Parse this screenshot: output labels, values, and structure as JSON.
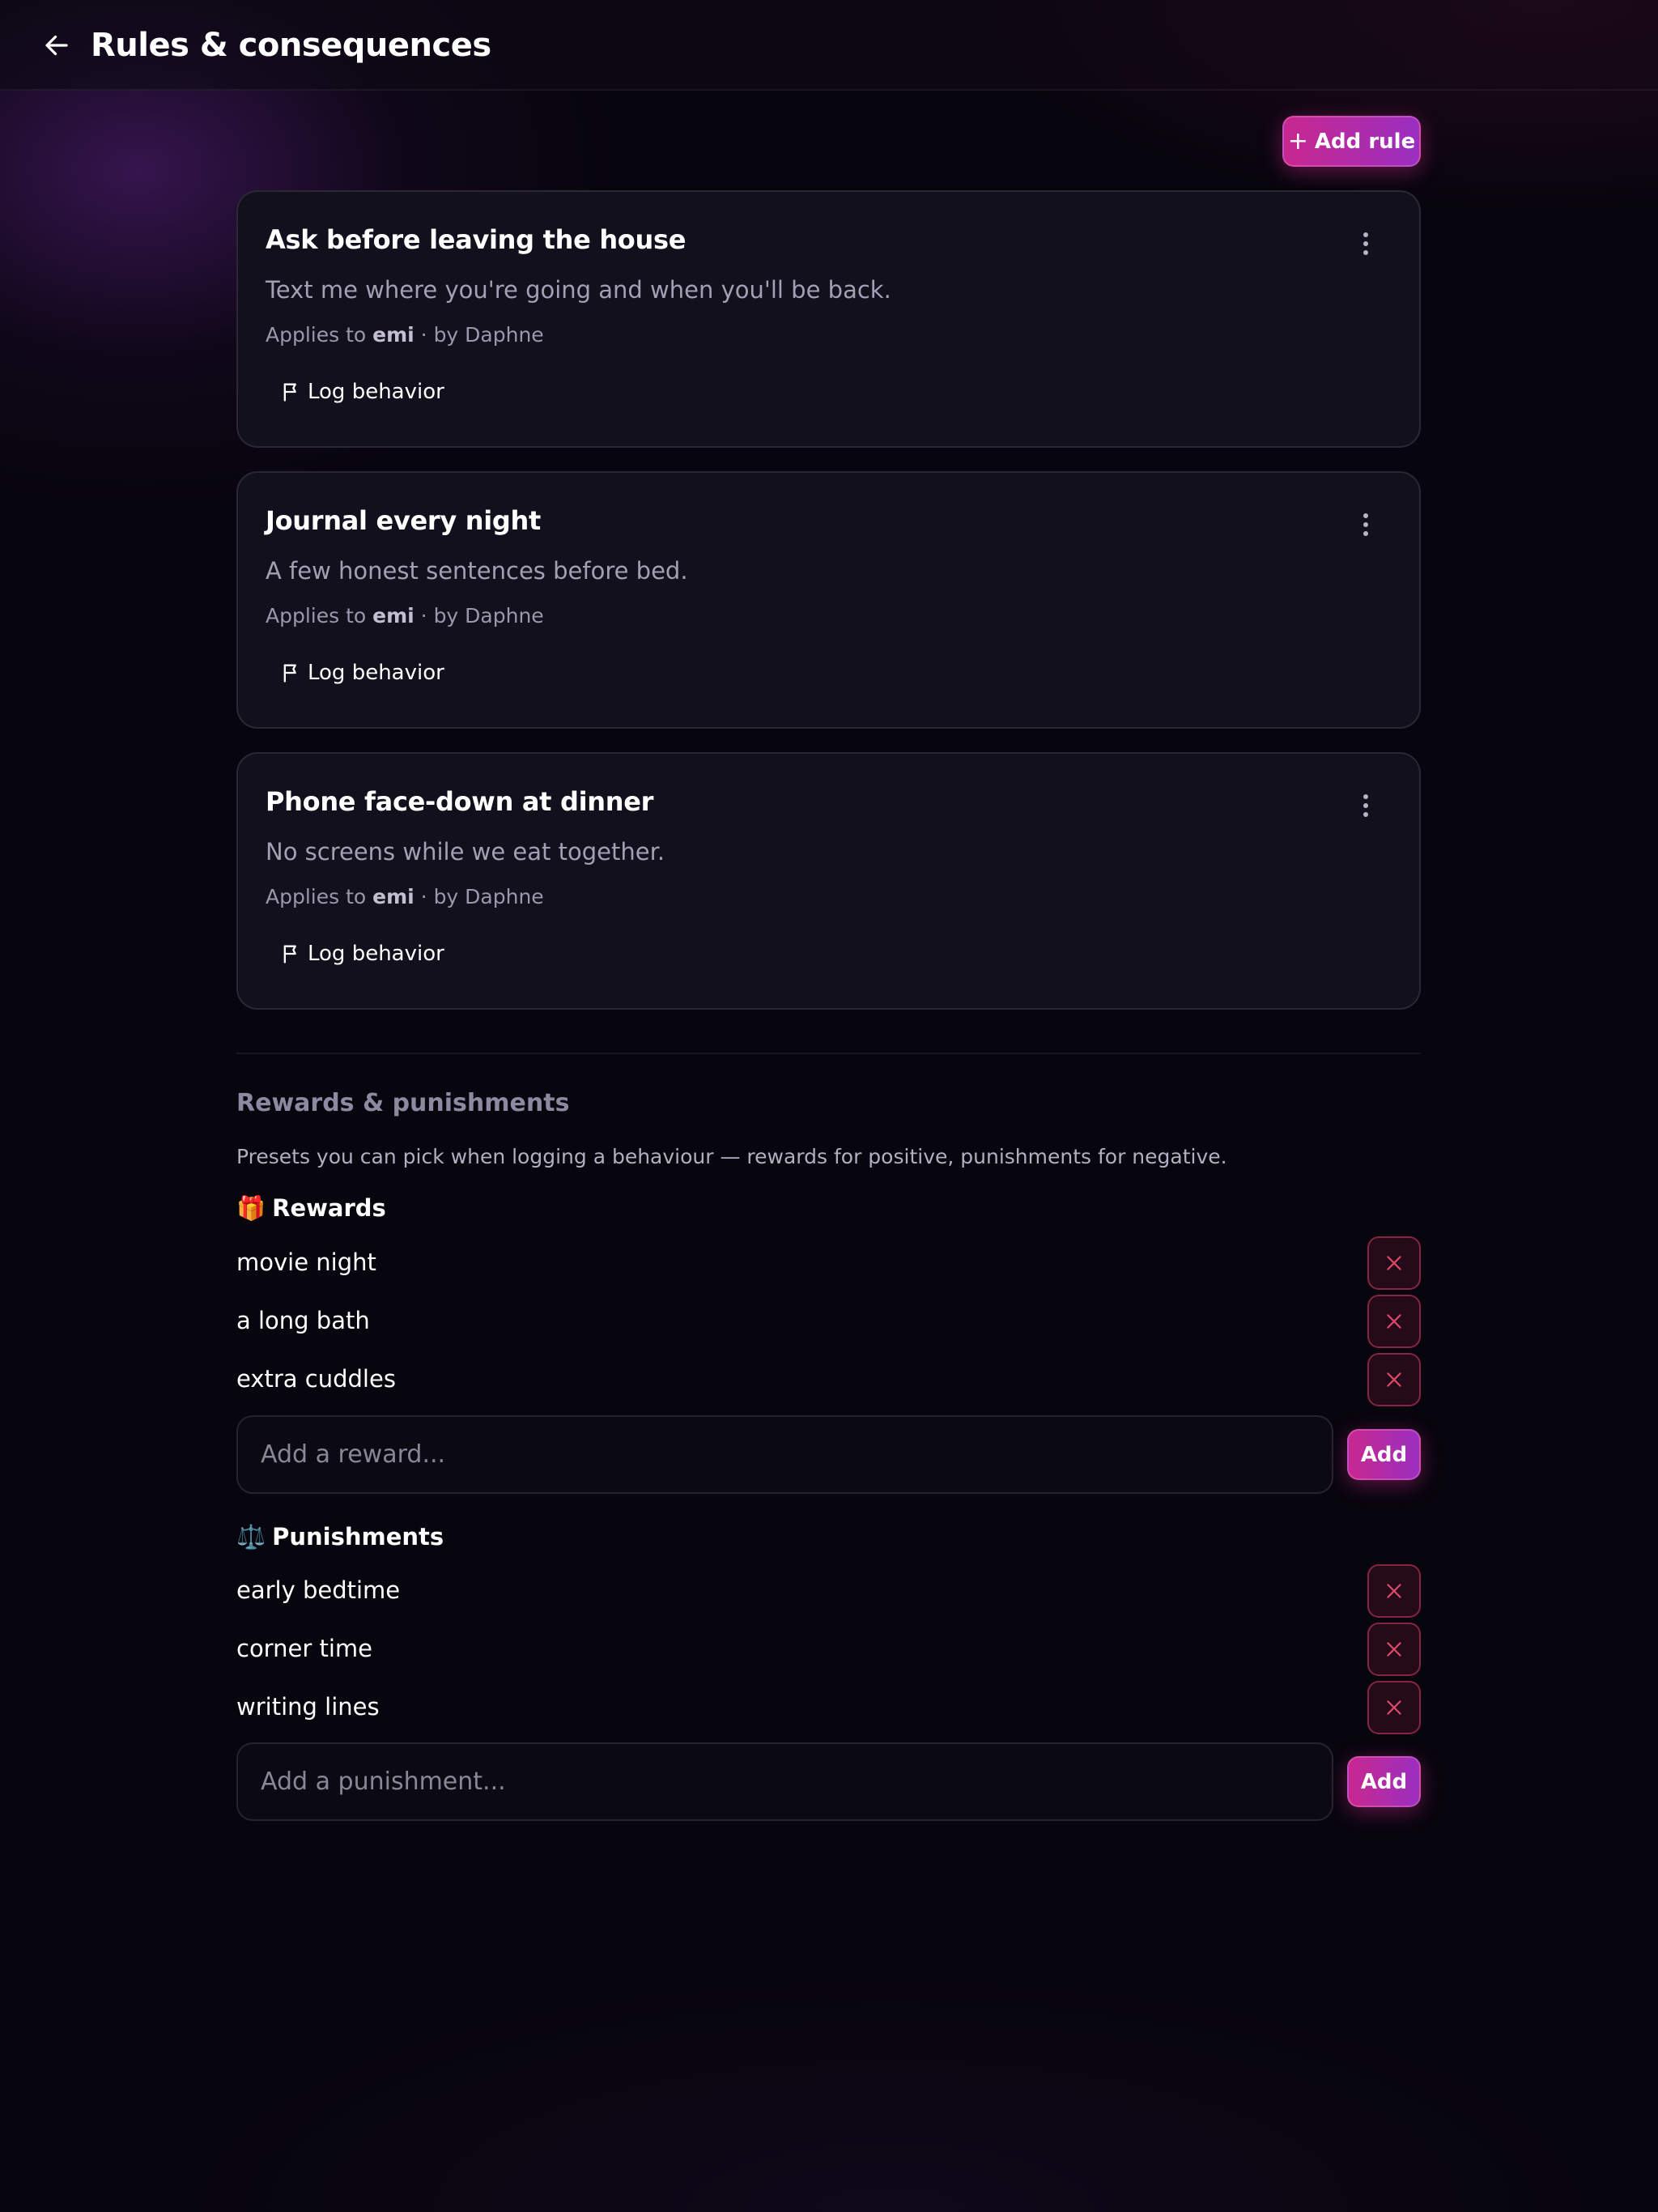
{
  "header": {
    "title": "Rules & consequences",
    "back_icon": "arrow-left-icon"
  },
  "toolbar": {
    "add_rule_label": "Add rule",
    "add_rule_icon": "+"
  },
  "rules": [
    {
      "title": "Ask before leaving the house",
      "description": "Text me where you're going and when you'll be back.",
      "applies_prefix": "Applies to",
      "applies_to": "emi",
      "by": "· by Daphne",
      "log_label": "Log behavior"
    },
    {
      "title": "Journal every night",
      "description": "A few honest sentences before bed.",
      "applies_prefix": "Applies to",
      "applies_to": "emi",
      "by": "· by Daphne",
      "log_label": "Log behavior"
    },
    {
      "title": "Phone face-down at dinner",
      "description": "No screens while we eat together.",
      "applies_prefix": "Applies to",
      "applies_to": "emi",
      "by": "· by Daphne",
      "log_label": "Log behavior"
    }
  ],
  "presets": {
    "title": "Rewards & punishments",
    "description": "Presets you can pick when logging a behaviour — rewards for positive, punishments for negative.",
    "rewards": {
      "emoji": "🎁",
      "title": "Rewards",
      "items": [
        "movie night",
        "a long bath",
        "extra cuddles"
      ],
      "placeholder": "Add a reward...",
      "add_label": "Add"
    },
    "punishments": {
      "emoji": "⚖️",
      "title": "Punishments",
      "items": [
        "early bedtime",
        "corner time",
        "writing lines"
      ],
      "placeholder": "Add a punishment...",
      "add_label": "Add"
    }
  },
  "colors": {
    "accent": "#c8288f",
    "accent_2": "#9a2fc0",
    "danger": "#e2486e",
    "card_bg": "#13101d"
  }
}
